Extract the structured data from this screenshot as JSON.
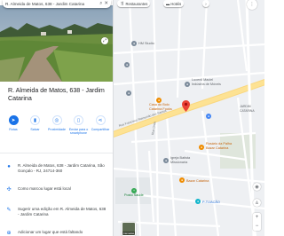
{
  "search": {
    "value": "R. Almeida de Matos, 638 - Jardim Catarina"
  },
  "place": {
    "title": "R. Almeida de Matos, 638 - Jardim Catarina"
  },
  "actions": [
    {
      "label": "Rotas",
      "icon": "directions-icon"
    },
    {
      "label": "Salvar",
      "icon": "bookmark-icon"
    },
    {
      "label": "Proximidade",
      "icon": "nearby-icon"
    },
    {
      "label": "Enviar para o smartphone",
      "icon": "send-to-phone-icon"
    },
    {
      "label": "Compartilhar",
      "icon": "share-icon"
    }
  ],
  "info": {
    "address": "R. Almeida de Matos, 638 - Jardim Catarina, São Gonçalo - RJ, 24714-360",
    "plus_code": "Como marcou lugar está local",
    "suggest": "Sugerir uma edição em R. Almeida de Matos, 638 - Jardim Catarina",
    "add_missing": "Adicionar um lugar que está faltando"
  },
  "map": {
    "chips": [
      "Restaurantes",
      "Hotéis"
    ],
    "labels": {
      "hm_studio": "HM Studio",
      "lucenil": "Lucenil Maciel\nIndústria de Móveis",
      "casa_do_bolo": "Casa do Bolo\nCatarina Fooks",
      "jardim_catarina": "JARDIM\nCATARINA",
      "rosario": "Rosário da Palha\nBazar Catarina",
      "igreja": "Igreja Batista\nMissionaria",
      "posto": "Posto Saúde",
      "tijacao": "P-TIJACÃO",
      "bazar_catarina": "Bazar Catarina",
      "road_main": "Rua Francisco Raimundo dos Santos",
      "road_ne": "Rua Onze"
    },
    "layers_label": "Camadas",
    "colors": {
      "accent": "#1a73e8",
      "pin": "#ea4335",
      "road_major": "#fde293"
    }
  }
}
